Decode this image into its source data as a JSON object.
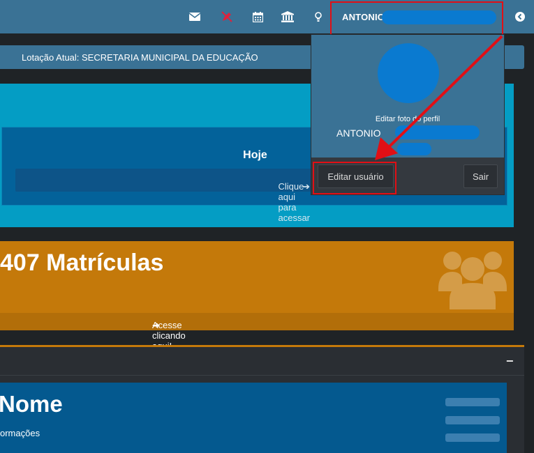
{
  "navbar": {
    "user_name": "ANTONIO",
    "icons": [
      "envelope-icon",
      "pencil-off-icon",
      "calendar-icon",
      "bank-icon",
      "lightbulb-icon",
      "logout-icon"
    ]
  },
  "lotacao": {
    "text": "Lotação Atual: SECRETARIA MUNICIPAL DA EDUCAÇÃO"
  },
  "today_panel": {
    "title": "Hoje",
    "link_label": "Clique aqui para acessar"
  },
  "enrollments_panel": {
    "title": "407 Matrículas",
    "footer_label": "Acesse clicando aqui!"
  },
  "name_card": {
    "title": "Nome",
    "subtitle": "ormações"
  },
  "user_menu": {
    "edit_photo_label": "Editar foto do perfil",
    "name": "ANTONIO",
    "edit_user_label": "Editar usuário",
    "logout_label": "Sair"
  },
  "colors": {
    "navbar": "#3a7295",
    "cyan_panel": "#049dc4",
    "orange_panel": "#c4790a",
    "blue_panel": "#04598f",
    "highlight": "#e10f15",
    "redaction": "#0a7ad0"
  }
}
